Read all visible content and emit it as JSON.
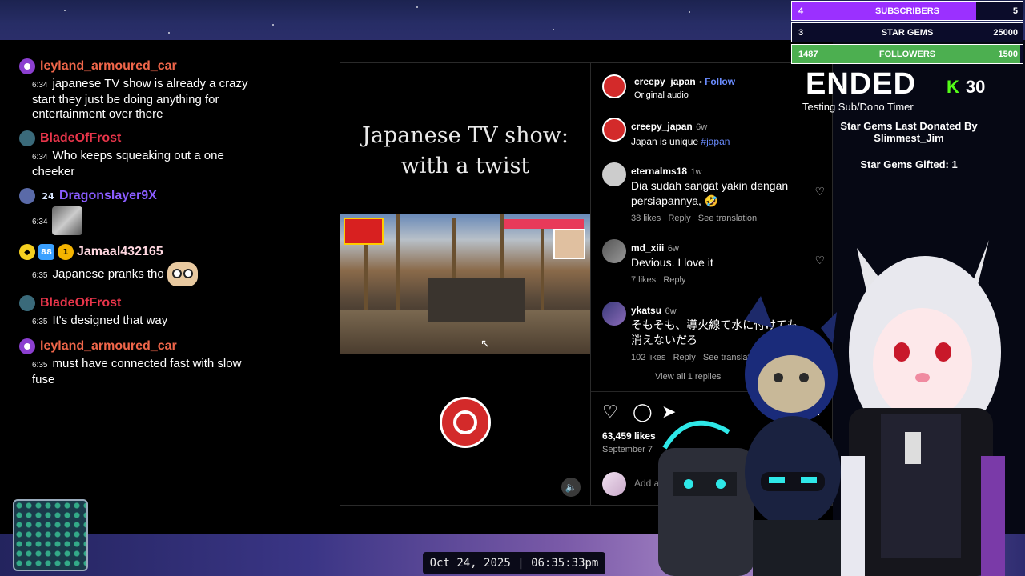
{
  "chat": {
    "messages": [
      {
        "user": "leyland_armoured_car",
        "time": "6:34",
        "text": "japanese TV show is already a crazy start they just be doing anything for entertainment over there"
      },
      {
        "user": "BladeOfFrost",
        "time": "6:34",
        "text": "Who keeps squeaking out a one cheeker"
      },
      {
        "user": "Dragonslayer9X",
        "time": "6:34",
        "text": "",
        "badge": "24"
      },
      {
        "user": "Jamaal432165",
        "time": "6:35",
        "text": "Japanese pranks tho",
        "badges": [
          "88",
          "1"
        ]
      },
      {
        "user": "BladeOfFrost",
        "time": "6:35",
        "text": "It's designed that way"
      },
      {
        "user": "leyland_armoured_car",
        "time": "6:35",
        "text": "must have connected fast with slow fuse"
      }
    ]
  },
  "instagram": {
    "video_caption_line1": "Japanese TV show:",
    "video_caption_line2": "with a twist",
    "header": {
      "account": "creepy_japan",
      "follow": "Follow",
      "audio": "Original audio"
    },
    "post": {
      "account": "creepy_japan",
      "age": "6w",
      "caption": "Japan is unique",
      "hashtag": "#japan"
    },
    "comments": [
      {
        "user": "eternalms18",
        "age": "1w",
        "text": "Dia sudah sangat yakin dengan persiapannya, 🤣",
        "likes": "38 likes",
        "reply": "Reply",
        "translate": "See translation"
      },
      {
        "user": "md_xiii",
        "age": "6w",
        "text": "Devious. I love it",
        "likes": "7 likes",
        "reply": "Reply"
      },
      {
        "user": "ykatsu",
        "age": "6w",
        "text": "そもそも、導火線て水に付けても消えないだろ",
        "likes": "102 likes",
        "reply": "Reply",
        "translate": "See translation",
        "view_replies": "View all 1 replies"
      }
    ],
    "likes_total": "63,459 likes",
    "date": "September 7",
    "add_comment_placeholder": "Add a comment..."
  },
  "goals": [
    {
      "current": "4",
      "label": "SUBSCRIBERS",
      "target": "5",
      "progress": 0.8,
      "color": "#9b30ff"
    },
    {
      "current": "3",
      "label": "STAR GEMS",
      "target": "25000",
      "progress": 0.0,
      "color": "#9b30ff"
    },
    {
      "current": "1487",
      "label": "FOLLOWERS",
      "target": "1500",
      "progress": 0.99,
      "color": "#4caf50"
    }
  ],
  "timer": {
    "status": "ENDED",
    "subtitle": "Testing Sub/Dono Timer"
  },
  "kick": {
    "icon": "kick-logo-icon",
    "viewers": "30"
  },
  "star_gems": {
    "last_donated_label": "Star Gems Last Donated By",
    "donor": "Slimmest_Jim",
    "gifted_label": "Star Gems Gifted: 1"
  },
  "clock": {
    "date": "Oct 24, 2025",
    "separator": "|",
    "time": "06:35:33pm"
  },
  "colors": {
    "follow_blue": "#6a8cff",
    "username_orange": "#f0664a",
    "username_red": "#e8354a",
    "username_violet": "#8a5cff",
    "kick_green": "#53fc18"
  }
}
